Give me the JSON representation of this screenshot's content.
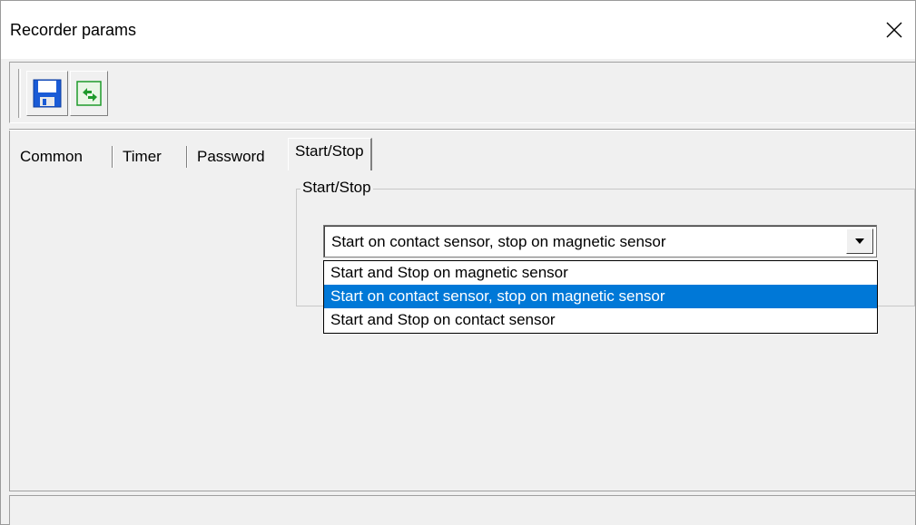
{
  "window": {
    "title": "Recorder params",
    "close_glyph": "✕"
  },
  "toolbar": {
    "buttons": [
      {
        "name": "save",
        "icon": "floppy-disk-save-icon",
        "color": "#1a5bd6"
      },
      {
        "name": "refresh",
        "icon": "green-refresh-arrows-icon",
        "color": "#1f9a2b"
      }
    ]
  },
  "tabs": [
    {
      "label": "Common",
      "active": false
    },
    {
      "label": "Timer",
      "active": false
    },
    {
      "label": "Password",
      "active": false
    },
    {
      "label": "Start/Stop",
      "active": true
    }
  ],
  "start_stop": {
    "group_label": "Start/Stop",
    "combo_value": "Start on contact sensor, stop on magnetic sensor",
    "options": [
      "Start and Stop on magnetic sensor",
      "Start on contact sensor, stop on magnetic sensor",
      "Start and Stop on contact sensor"
    ],
    "selected_index": 1
  },
  "colors": {
    "selection": "#0078d7",
    "face": "#f0f0f0"
  }
}
